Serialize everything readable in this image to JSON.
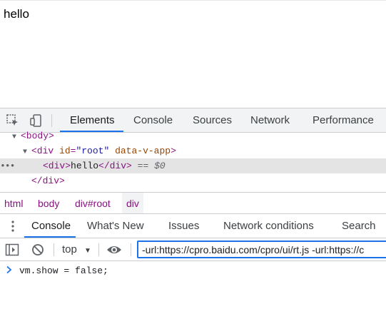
{
  "page": {
    "text": "hello"
  },
  "devtools": {
    "main_tabs": [
      "Elements",
      "Console",
      "Sources",
      "Network",
      "Performance"
    ],
    "active_tab": "Elements",
    "dom_tree": {
      "body_tag": "<body>",
      "div_open": "<div",
      "div_attr1_name": "id",
      "div_attr1_value": "\"root\"",
      "div_attr2_name": "data-v-app",
      "div_open_close": ">",
      "selected_open": "<div>",
      "selected_text": "hello",
      "selected_close": "</div>",
      "selected_suffix_eq": "==",
      "selected_suffix_var": "$0",
      "div_close": "</div>",
      "dots": "•••"
    },
    "breadcrumbs": [
      "html",
      "body",
      "div#root",
      "div"
    ],
    "drawer_tabs": [
      "Console",
      "What's New",
      "Issues",
      "Network conditions",
      "Search"
    ],
    "active_drawer_tab": "Console",
    "console_toolbar": {
      "context": "top",
      "filter_value": "-url:https://cpro.baidu.com/cpro/ui/rt.js -url:https://c"
    },
    "console_input": "vm.show = false;",
    "colors": {
      "accent": "#1a73e8",
      "tag": "#881280",
      "attr_name": "#994500",
      "attr_value": "#1a1aa6"
    }
  }
}
